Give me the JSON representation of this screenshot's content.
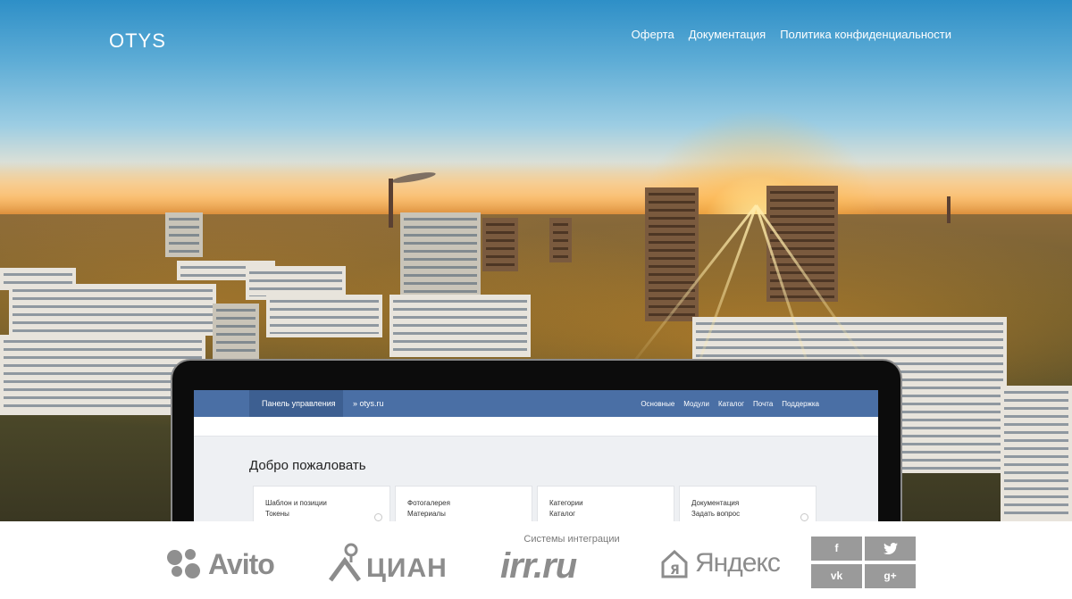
{
  "header": {
    "brand": "OTYS",
    "nav": [
      "Оферта",
      "Документация",
      "Политика конфиденциальности"
    ]
  },
  "laptop_screen": {
    "panel_label": "Панель управления",
    "breadcrumb": "» otys.ru",
    "menu": [
      "Основные",
      "Модули",
      "Каталог",
      "Почта",
      "Поддержка"
    ],
    "welcome_title": "Добро пожаловать",
    "cards": [
      {
        "line1": "Шаблон и позиции",
        "line2": "Токены"
      },
      {
        "line1": "Фотогалерея",
        "line2": "Материалы"
      },
      {
        "line1": "Категории",
        "line2": "Каталог"
      },
      {
        "line1": "Документация",
        "line2": "Задать вопрос"
      }
    ]
  },
  "footer": {
    "integrations_label": "Системы интеграции",
    "partners": [
      "Avito",
      "ЦИАН",
      "irr.ru",
      "Яндекс"
    ],
    "social": [
      {
        "icon": "facebook-icon",
        "glyph": "f"
      },
      {
        "icon": "twitter-icon",
        "glyph": "🐦"
      },
      {
        "icon": "vk-icon",
        "glyph": "vk"
      },
      {
        "icon": "google-plus-icon",
        "glyph": "g+"
      }
    ]
  },
  "colors": {
    "admin_bar": "#4a6fa5",
    "logo_gray": "#8c8c8c",
    "social_gray": "#9a9a9a"
  }
}
